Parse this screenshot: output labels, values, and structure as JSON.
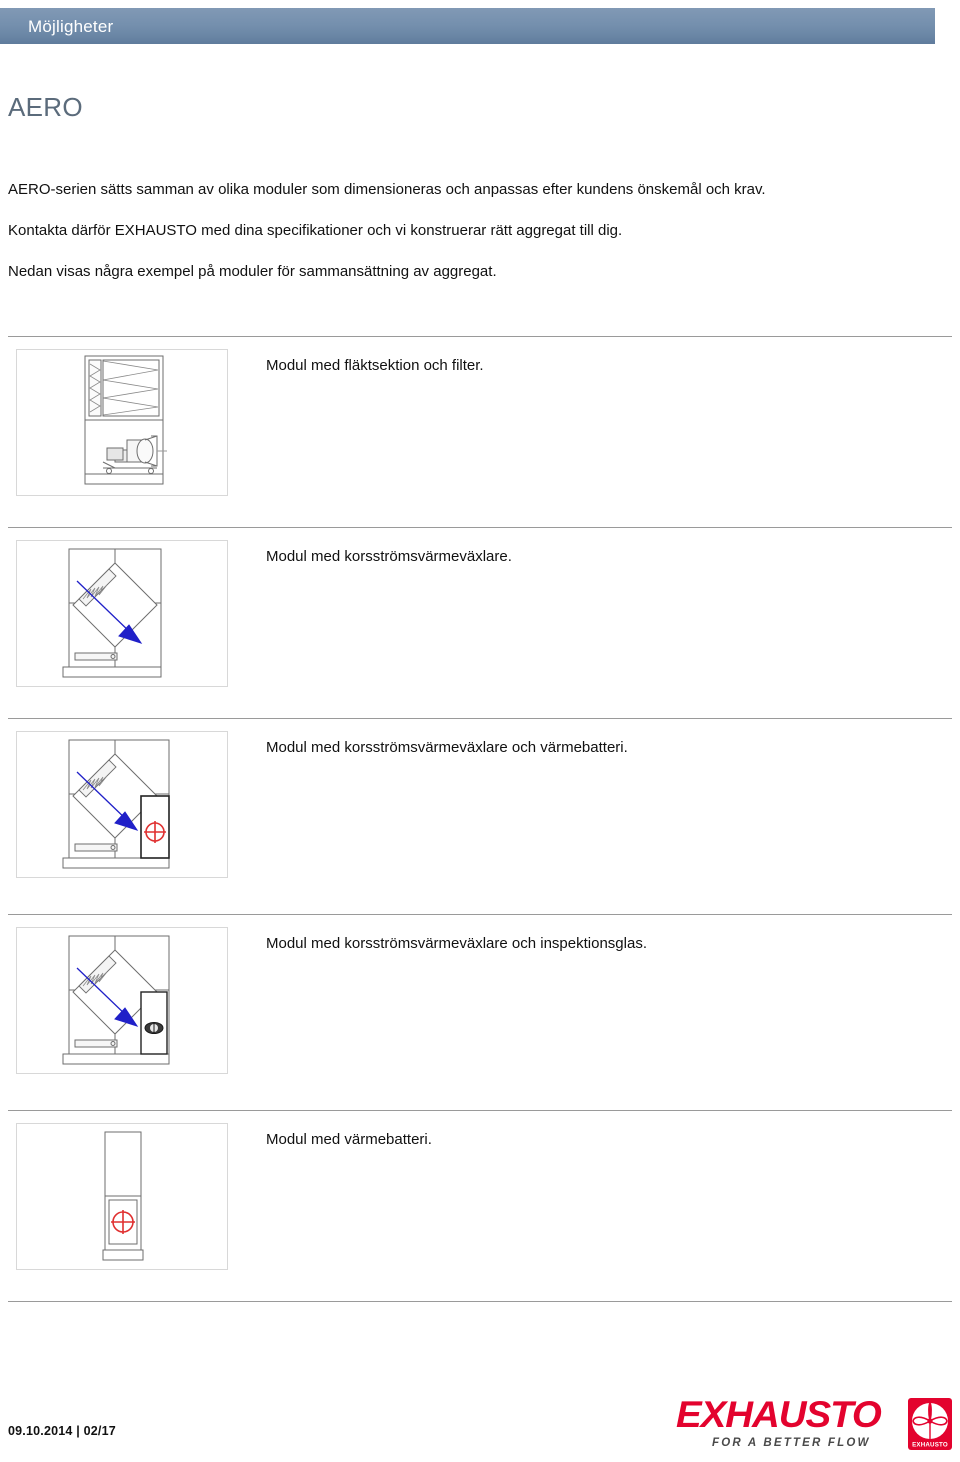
{
  "header": {
    "title": "Möjligheter",
    "band_color": "#7590ae"
  },
  "page_title": "AERO",
  "title_color": "#5b6b7b",
  "intro": {
    "paragraph1": "AERO-serien sätts samman av olika moduler som dimensioneras och anpassas efter kundens önskemål och krav.",
    "paragraph2": "Kontakta därför EXHAUSTO med dina specifikationer och vi konstruerar rätt aggregat till dig.",
    "paragraph3": "Nedan visas några exempel på moduler för sammansättning av aggregat."
  },
  "modules": [
    {
      "caption": "Modul med fläktsektion och filter.",
      "figure": "fan-section-and-filter-drawing"
    },
    {
      "caption": "Modul med korsströmsvärmeväxlare.",
      "figure": "cross-flow-heat-exchanger-drawing"
    },
    {
      "caption": "Modul med korsströmsvärmeväxlare och värmebatteri.",
      "figure": "cross-flow-heat-exchanger-with-heating-coil-drawing"
    },
    {
      "caption": "Modul med korsströmsvärmeväxlare och inspektionsglas.",
      "figure": "cross-flow-heat-exchanger-with-inspection-glass-drawing"
    },
    {
      "caption": "Modul med värmebatteri.",
      "figure": "heating-coil-drawing"
    }
  ],
  "footer": {
    "date_and_page": "09.10.2014 | 02/17",
    "logo_text": "EXHAUSTO",
    "logo_tagline": "FOR A BETTER FLOW",
    "logo_mark_label": "EXHAUSTO",
    "logo_color": "#e3032e"
  },
  "drawing_colors": {
    "line": "#6e6e6e",
    "line_dark": "#222222",
    "arrow_blue": "#2020c8",
    "coil_red": "#e03030",
    "fill_light": "#f2f2f2"
  }
}
